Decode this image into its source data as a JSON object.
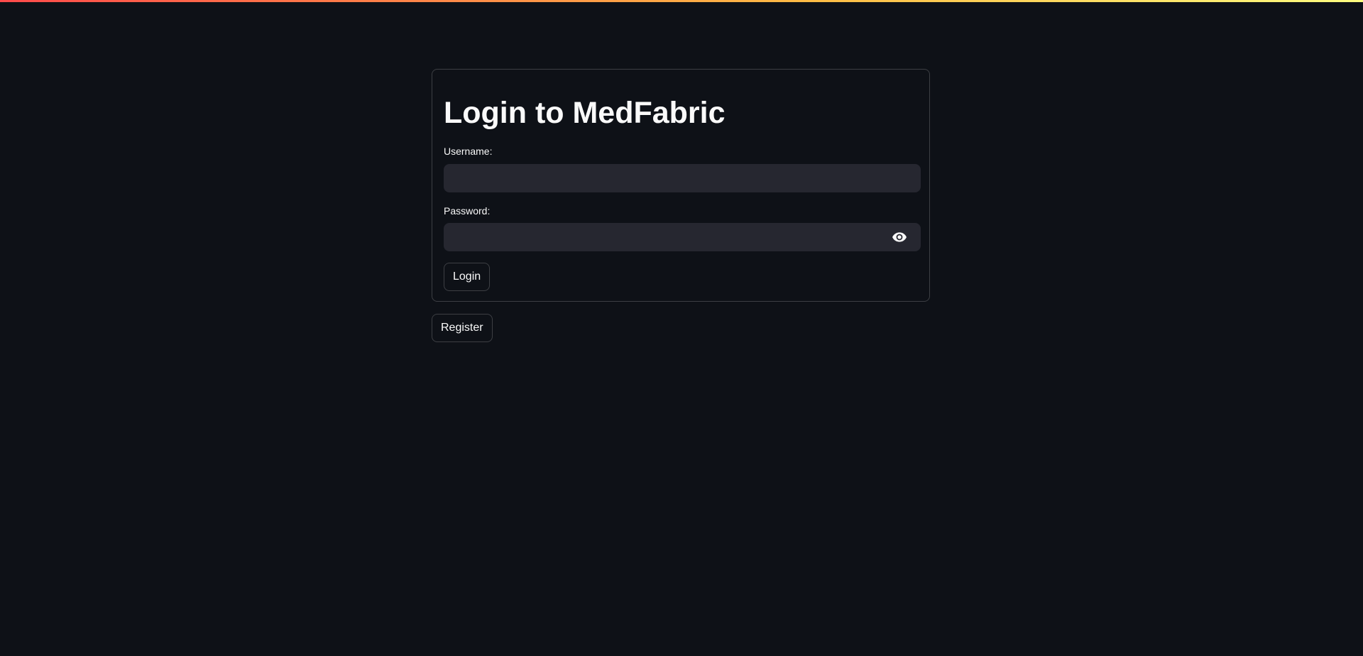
{
  "login_form": {
    "title": "Login to MedFabric",
    "username_label": "Username:",
    "username_value": "",
    "password_label": "Password:",
    "password_value": "",
    "show_password_icon": "eye-icon",
    "login_button_label": "Login"
  },
  "register_button_label": "Register",
  "colors": {
    "background": "#0e1117",
    "input_background": "#262730",
    "text": "#fafafa",
    "top_gradient": [
      "#ff4b4b",
      "#ffbd45",
      "#fffd80"
    ]
  }
}
